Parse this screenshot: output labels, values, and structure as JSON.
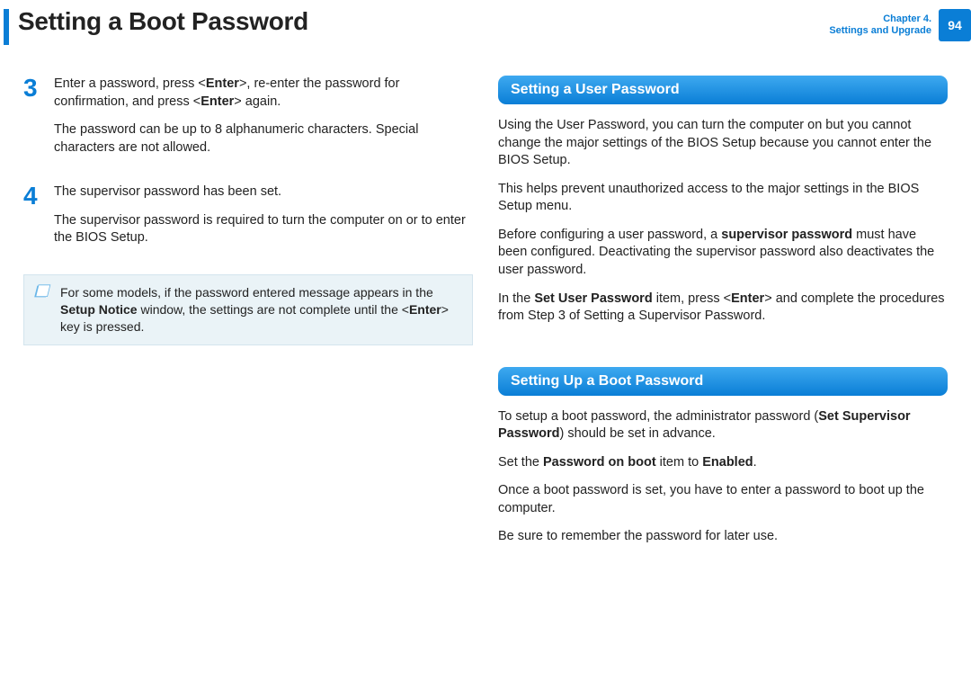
{
  "header": {
    "title": "Setting a Boot Password",
    "chapter_line1": "Chapter 4.",
    "chapter_line2": "Settings and Upgrade",
    "page_number": "94"
  },
  "left": {
    "step3": {
      "num": "3",
      "p1_a": "Enter a password, press <",
      "p1_b": "Enter",
      "p1_c": ">, re-enter the password for confirmation, and press <",
      "p1_d": "Enter",
      "p1_e": "> again.",
      "p2": "The password can be up to 8 alphanumeric characters. Special characters are not allowed."
    },
    "step4": {
      "num": "4",
      "p1": "The supervisor password has been set.",
      "p2": "The supervisor password is required to turn the computer on or to enter the BIOS Setup."
    },
    "note": {
      "a": "For some models, if the password entered message appears in the ",
      "b": "Setup Notice",
      "c": " window, the settings are not complete until the <",
      "d": "Enter",
      "e": "> key is pressed."
    }
  },
  "right": {
    "h1": "Setting a User Password",
    "p1": "Using the User Password, you can turn the computer on but you cannot change the major settings of the BIOS Setup because you cannot enter the BIOS Setup.",
    "p2": "This helps prevent unauthorized access to the major settings in the BIOS Setup menu.",
    "p3_a": "Before configuring a user password, a ",
    "p3_b": "supervisor password",
    "p3_c": " must have been configured. Deactivating the supervisor password also deactivates the user password.",
    "p4_a": "In the ",
    "p4_b": "Set User Password",
    "p4_c": " item, press <",
    "p4_d": "Enter",
    "p4_e": "> and complete the procedures from Step 3 of Setting a Supervisor Password.",
    "h2": "Setting Up a Boot Password",
    "q1_a": "To setup a boot password, the administrator password (",
    "q1_b": "Set Supervisor Password",
    "q1_c": ") should be set in advance.",
    "q2_a": "Set the ",
    "q2_b": "Password on boot",
    "q2_c": " item to ",
    "q2_d": "Enabled",
    "q2_e": ".",
    "q3": "Once a boot password is set, you have to enter a password to boot up the computer.",
    "q4": "Be sure to remember the password for later use."
  }
}
